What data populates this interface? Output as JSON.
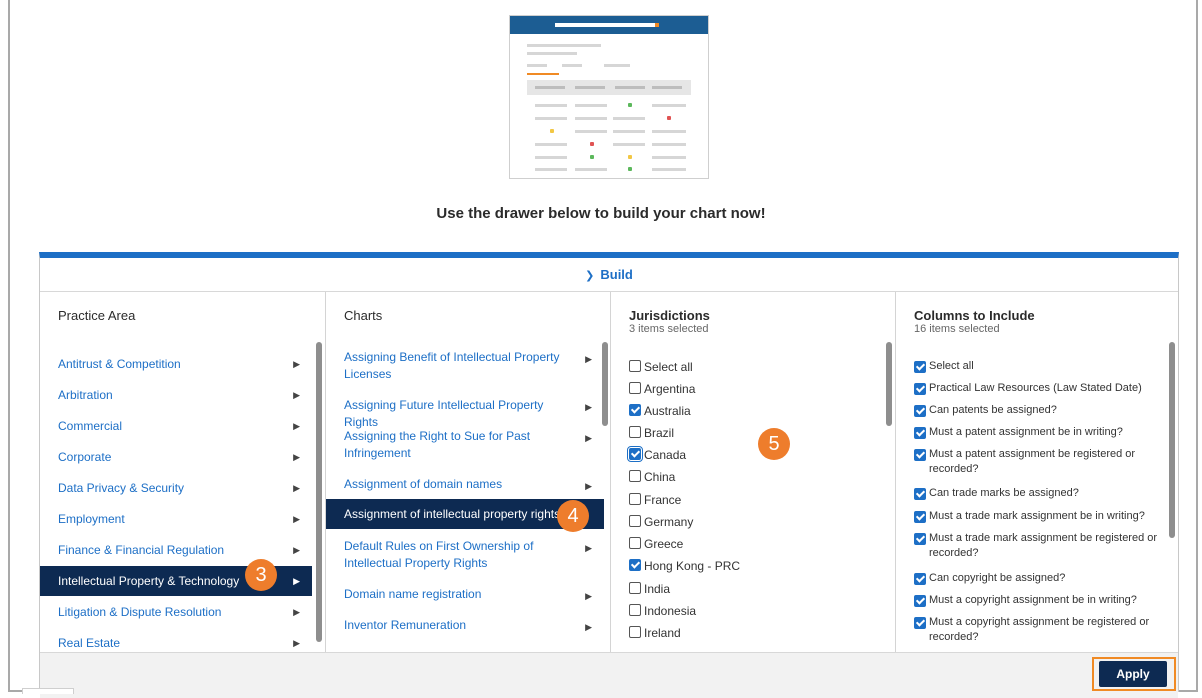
{
  "heading": "Use the drawer below to build your chart now!",
  "drawer": {
    "build_label": "Build",
    "apply_label": "Apply"
  },
  "practice_area": {
    "header": "Practice Area",
    "items": [
      "Antitrust & Competition",
      "Arbitration",
      "Commercial",
      "Corporate",
      "Data Privacy & Security",
      "Employment",
      "Finance & Financial Regulation",
      "Intellectual Property & Technology",
      "Litigation & Dispute Resolution",
      "Real Estate"
    ],
    "selected": "Intellectual Property & Technology"
  },
  "charts": {
    "header": "Charts",
    "items": [
      "Assigning Benefit of Intellectual Property Licenses",
      "Assigning Future Intellectual Property Rights",
      "Assigning the Right to Sue for Past Infringement",
      "Assignment of domain names",
      "Assignment of intellectual property rights",
      "Default Rules on First Ownership of Intellectual Property Rights",
      "Domain name registration",
      "Inventor Remuneration"
    ],
    "selected": "Assignment of intellectual property rights"
  },
  "jurisdictions": {
    "header": "Jurisdictions",
    "subtitle": "3 items selected",
    "items": [
      {
        "label": "Select all",
        "checked": false
      },
      {
        "label": "Argentina",
        "checked": false
      },
      {
        "label": "Australia",
        "checked": true
      },
      {
        "label": "Brazil",
        "checked": false
      },
      {
        "label": "Canada",
        "checked": true
      },
      {
        "label": "China",
        "checked": false
      },
      {
        "label": "France",
        "checked": false
      },
      {
        "label": "Germany",
        "checked": false
      },
      {
        "label": "Greece",
        "checked": false
      },
      {
        "label": "Hong Kong - PRC",
        "checked": true
      },
      {
        "label": "India",
        "checked": false
      },
      {
        "label": "Indonesia",
        "checked": false
      },
      {
        "label": "Ireland",
        "checked": false
      }
    ]
  },
  "columns": {
    "header": "Columns to Include",
    "subtitle": "16 items selected",
    "items": [
      "Select all",
      "Practical Law Resources (Law Stated Date)",
      "Can patents be assigned?",
      "Must a patent assignment be in writing?",
      "Must a patent assignment be registered or recorded?",
      "Can trade marks be assigned?",
      "Must a trade mark assignment be in writing?",
      "Must a trade mark assignment be registered or recorded?",
      "Can copyright be assigned?",
      "Must a copyright assignment be in writing?",
      "Must a copyright assignment be registered or recorded?"
    ]
  },
  "step_badges": [
    "3",
    "4",
    "5"
  ],
  "colors": {
    "accent_blue": "#1d6fc6",
    "selected_navy": "#0d2a52",
    "badge_orange": "#ee7d2c"
  }
}
